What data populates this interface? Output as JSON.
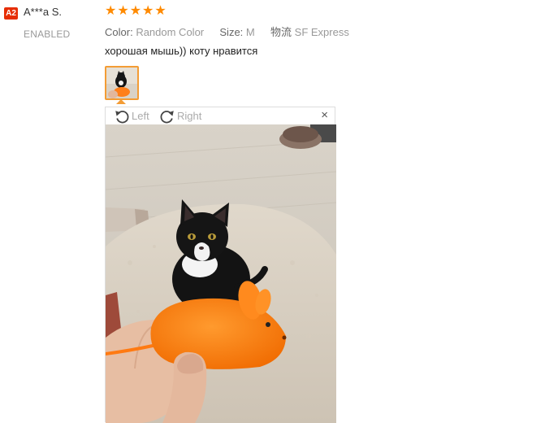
{
  "reviewer": {
    "badge": "A2",
    "name": "A***a S.",
    "status": "ENABLED"
  },
  "rating": {
    "stars": 5,
    "max": 5
  },
  "attributes": [
    {
      "key": "Color:",
      "value": "Random Color"
    },
    {
      "key": "Size:",
      "value": "M"
    },
    {
      "key": "物流",
      "value": "SF Express"
    }
  ],
  "review_text": "хорошая мышь)) коту нравится",
  "viewer": {
    "rotate_left_label": "Left",
    "rotate_right_label": "Right",
    "close_label": "×"
  },
  "colors": {
    "star": "#ff8a00",
    "badge": "#e62e04",
    "thumb_border": "#f39c35",
    "muted_text": "#999999"
  }
}
